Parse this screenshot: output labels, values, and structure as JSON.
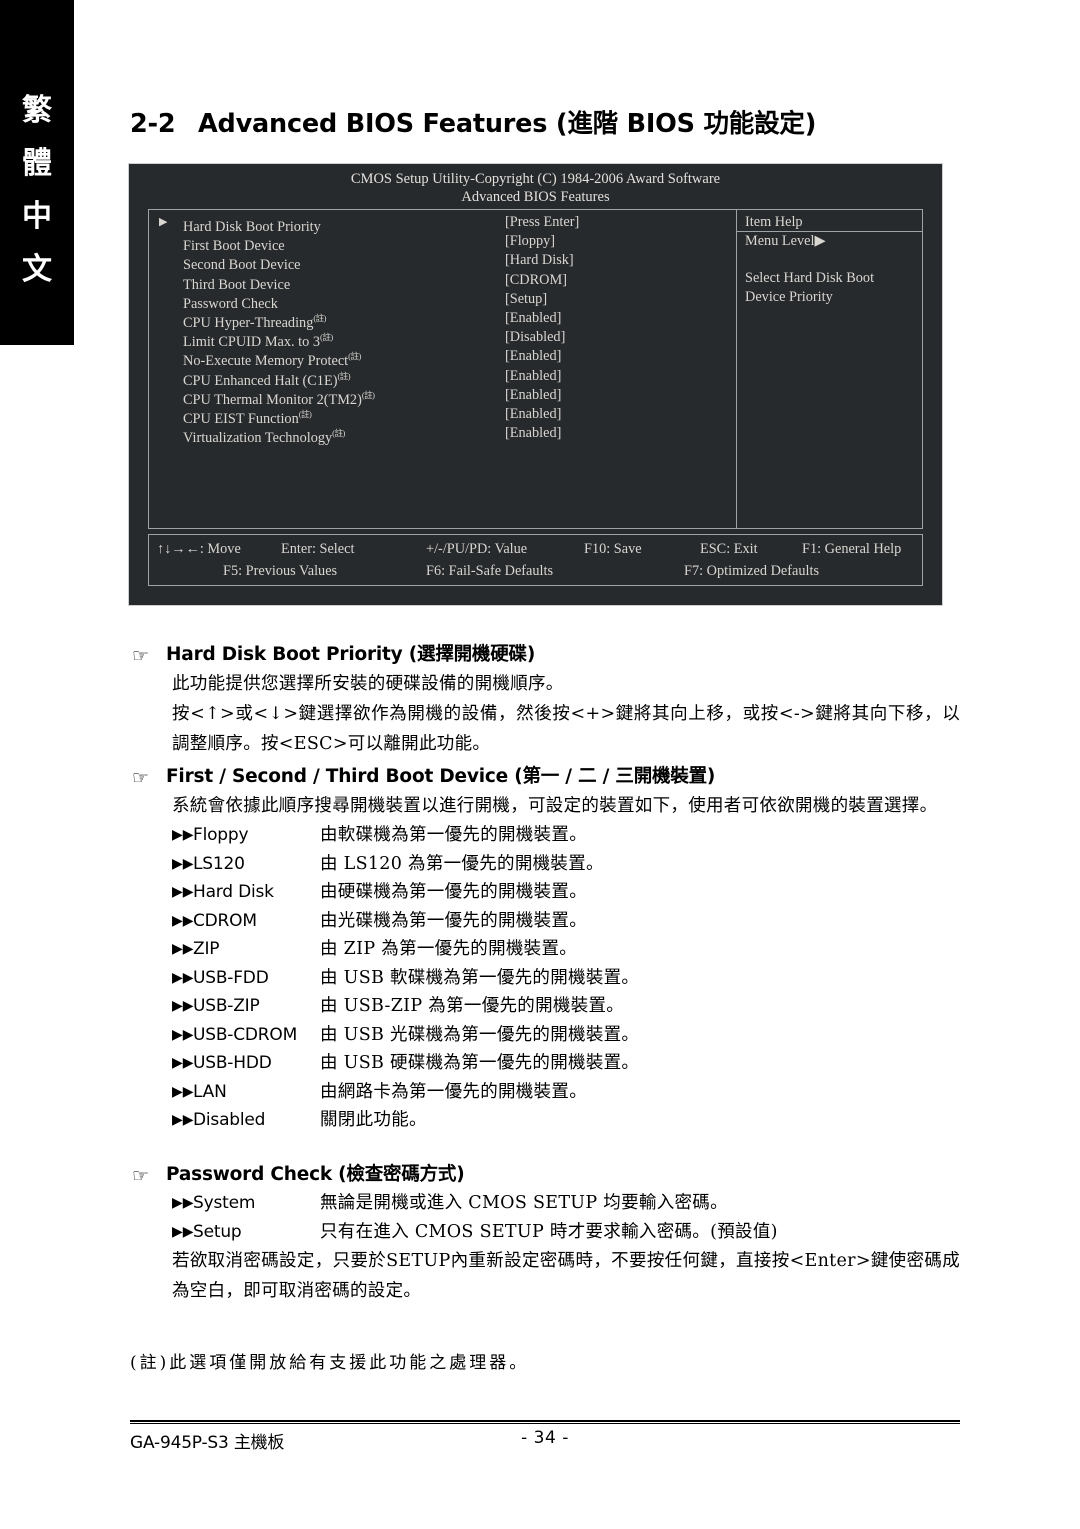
{
  "side_tab": {
    "chars": [
      "繁",
      "體",
      "中",
      "文"
    ]
  },
  "heading": {
    "number": "2-2",
    "text": "Advanced BIOS Features (進階 BIOS 功能設定)"
  },
  "bios": {
    "title": "CMOS Setup Utility-Copyright (C) 1984-2006 Award Software",
    "subtitle": "Advanced BIOS Features",
    "rows": [
      {
        "arrow": "▶",
        "label": "Hard Disk Boot Priority",
        "sup": "",
        "value": "[Press Enter]"
      },
      {
        "arrow": "",
        "label": "First Boot Device",
        "sup": "",
        "value": "[Floppy]"
      },
      {
        "arrow": "",
        "label": "Second Boot Device",
        "sup": "",
        "value": "[Hard Disk]"
      },
      {
        "arrow": "",
        "label": "Third Boot Device",
        "sup": "",
        "value": "[CDROM]"
      },
      {
        "arrow": "",
        "label": "Password Check",
        "sup": "",
        "value": "[Setup]"
      },
      {
        "arrow": "",
        "label": "CPU Hyper-Threading",
        "sup": "(註)",
        "value": "[Enabled]"
      },
      {
        "arrow": "",
        "label": "Limit CPUID Max. to 3",
        "sup": "(註)",
        "value": "[Disabled]"
      },
      {
        "arrow": "",
        "label": "No-Execute Memory Protect",
        "sup": "(註)",
        "value": "[Enabled]"
      },
      {
        "arrow": "",
        "label": "CPU Enhanced Halt (C1E)",
        "sup": "(註)",
        "value": "[Enabled]"
      },
      {
        "arrow": "",
        "label": "CPU Thermal Monitor 2(TM2)",
        "sup": "(註)",
        "value": "[Enabled]"
      },
      {
        "arrow": "",
        "label": "CPU EIST Function",
        "sup": "(註)",
        "value": "[Enabled]"
      },
      {
        "arrow": "",
        "label": "Virtualization Technology",
        "sup": "(註)",
        "value": "[Enabled]"
      }
    ],
    "help": {
      "title": "Item Help",
      "menu_level": "Menu Level▶",
      "lines": [
        "Select Hard Disk Boot",
        "Device Priority"
      ]
    },
    "footer": {
      "line1": [
        "↑↓→←: Move",
        "Enter: Select",
        "+/-/PU/PD: Value",
        "F10: Save",
        "ESC: Exit",
        "F1: General Help"
      ],
      "line2": [
        "F5: Previous Values",
        "F6: Fail-Safe Defaults",
        "F7: Optimized Defaults"
      ]
    }
  },
  "sections": [
    {
      "hand": "☞",
      "head": "Hard Disk Boot Priority (選擇開機硬碟)",
      "paragraphs": [
        "此功能提供您選擇所安裝的硬碟設備的開機順序。",
        "按<↑>或<↓>鍵選擇欲作為開機的設備，然後按<+>鍵將其向上移，或按<->鍵將其向下移，以調整順序。按<ESC>可以離開此功能。"
      ]
    },
    {
      "hand": "☞",
      "head": "First / Second / Third Boot Device (第一 / 二 / 三開機裝置)",
      "paragraphs": [
        "系統會依據此順序搜尋開機裝置以進行開機，可設定的裝置如下，使用者可依欲開機的裝置選擇。"
      ],
      "options": [
        {
          "marker": "▶▶",
          "name": "Floppy",
          "desc": "由軟碟機為第一優先的開機裝置。"
        },
        {
          "marker": "▶▶",
          "name": "LS120",
          "desc": "由 LS120 為第一優先的開機裝置。"
        },
        {
          "marker": "▶▶",
          "name": "Hard Disk",
          "desc": "由硬碟機為第一優先的開機裝置。"
        },
        {
          "marker": "▶▶",
          "name": "CDROM",
          "desc": "由光碟機為第一優先的開機裝置。"
        },
        {
          "marker": "▶▶",
          "name": "ZIP",
          "desc": "由 ZIP 為第一優先的開機裝置。"
        },
        {
          "marker": "▶▶",
          "name": "USB-FDD",
          "desc": "由 USB 軟碟機為第一優先的開機裝置。"
        },
        {
          "marker": "▶▶",
          "name": "USB-ZIP",
          "desc": "由 USB-ZIP 為第一優先的開機裝置。"
        },
        {
          "marker": "▶▶",
          "name": "USB-CDROM",
          "desc": "由 USB 光碟機為第一優先的開機裝置。"
        },
        {
          "marker": "▶▶",
          "name": "USB-HDD",
          "desc": "由 USB 硬碟機為第一優先的開機裝置。"
        },
        {
          "marker": "▶▶",
          "name": "LAN",
          "desc": "由網路卡為第一優先的開機裝置。"
        },
        {
          "marker": "▶▶",
          "name": "Disabled",
          "desc": "關閉此功能。"
        }
      ]
    },
    {
      "hand": "☞",
      "head": "Password Check (檢查密碼方式)",
      "options": [
        {
          "marker": "▶▶",
          "name": "System",
          "desc": "無論是開機或進入 CMOS SETUP 均要輸入密碼。"
        },
        {
          "marker": "▶▶",
          "name": "Setup",
          "desc": "只有在進入 CMOS SETUP 時才要求輸入密碼。(預設值)"
        }
      ],
      "paragraphs_after": [
        "若欲取消密碼設定，只要於SETUP內重新設定密碼時，不要按任何鍵，直接按<Enter>鍵使密碼成為空白，即可取消密碼的設定。"
      ]
    }
  ],
  "note": "(註)此選項僅開放給有支援此功能之處理器。",
  "footer": {
    "left": "GA-945P-S3 主機板",
    "page": "- 34 -"
  }
}
